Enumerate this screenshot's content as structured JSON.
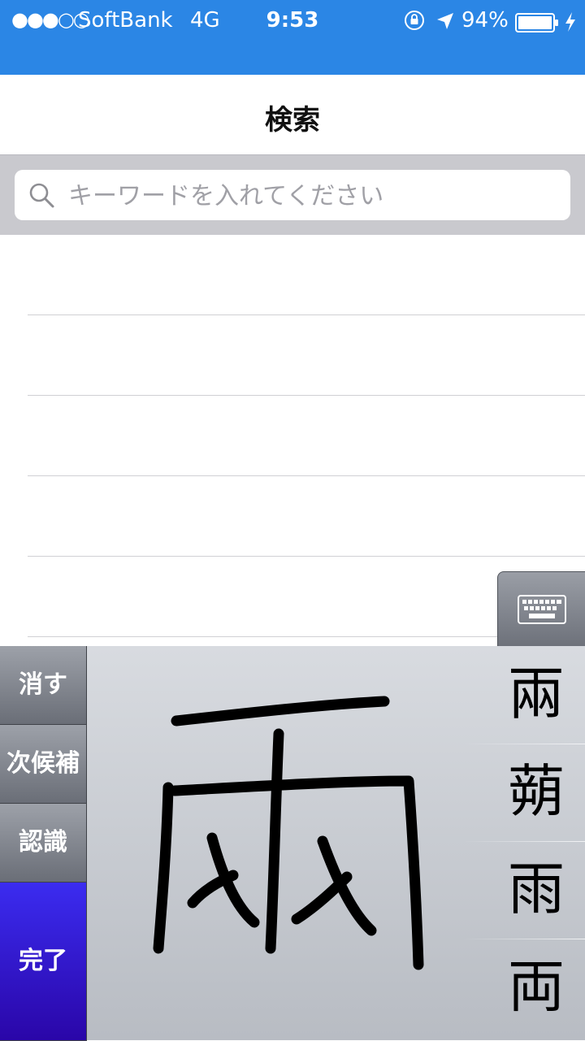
{
  "status_bar": {
    "signal": "●●●○○",
    "carrier": "SoftBank",
    "network": "4G",
    "time": "9:53",
    "battery_percent": "94%",
    "background_color": "#2b86e5"
  },
  "nav": {
    "title": "検索"
  },
  "search": {
    "placeholder": "キーワードを入れてください",
    "value": ""
  },
  "list": {
    "rows": 5
  },
  "handwriting": {
    "buttons": {
      "erase": "消す",
      "next_candidate": "次候補",
      "recognize": "認識",
      "done": "完了"
    },
    "candidates": [
      "兩",
      "蒴",
      "雨",
      "両"
    ],
    "done_color": "#3b2cf0"
  }
}
